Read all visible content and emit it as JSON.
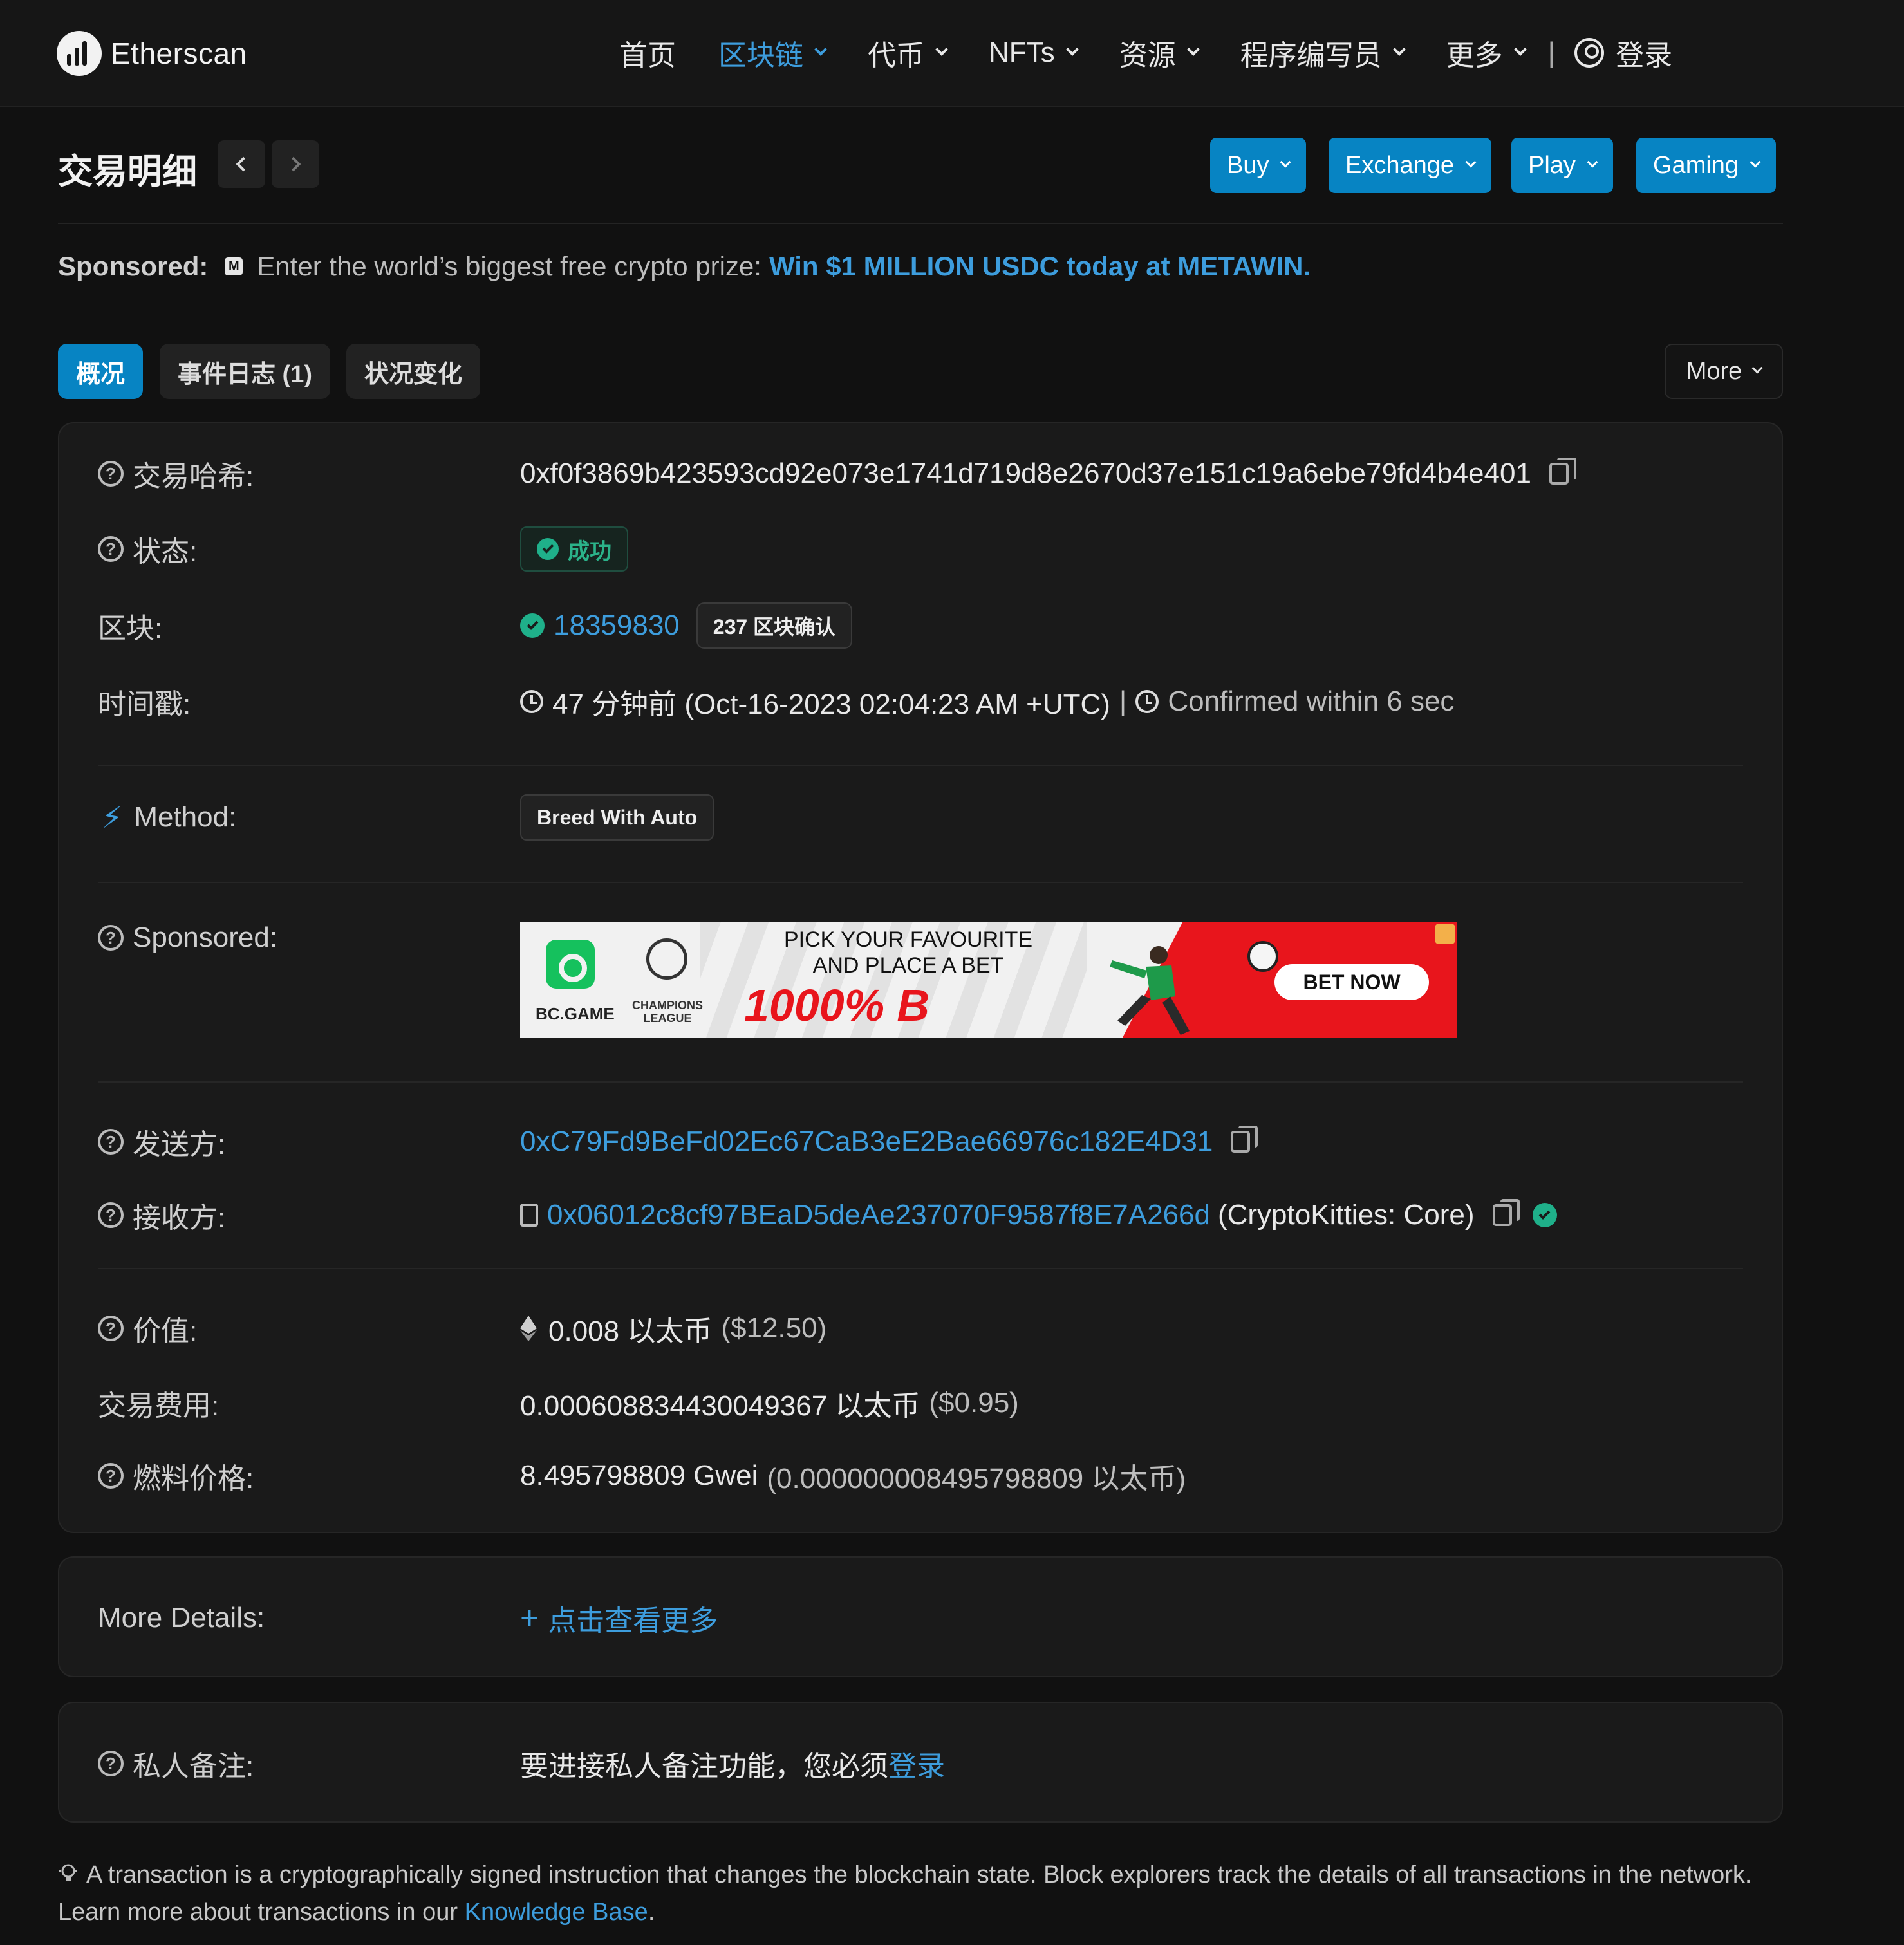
{
  "app": {
    "brand": "Etherscan"
  },
  "nav": {
    "items": [
      {
        "label": "首页",
        "active": false,
        "dropdown": false
      },
      {
        "label": "区块链",
        "active": true,
        "dropdown": true
      },
      {
        "label": "代币",
        "active": false,
        "dropdown": true
      },
      {
        "label": "NFTs",
        "active": false,
        "dropdown": true
      },
      {
        "label": "资源",
        "active": false,
        "dropdown": true
      },
      {
        "label": "程序编写员",
        "active": false,
        "dropdown": true
      },
      {
        "label": "更多",
        "active": false,
        "dropdown": true
      }
    ],
    "separator": "|",
    "login_label": "登录"
  },
  "page": {
    "title": "交易明细"
  },
  "cta_buttons": [
    {
      "label": "Buy"
    },
    {
      "label": "Exchange"
    },
    {
      "label": "Play"
    },
    {
      "label": "Gaming"
    }
  ],
  "sponsored_line": {
    "prefix": "Sponsored:",
    "text": "Enter the world’s biggest free crypto prize:",
    "link": "Win $1 MILLION USDC today at METAWIN."
  },
  "tabs": [
    {
      "label": "概况",
      "active": true
    },
    {
      "label": "事件日志 (1)",
      "active": false
    },
    {
      "label": "状况变化",
      "active": false
    }
  ],
  "more_button": "More",
  "details": {
    "hash_label": "交易哈希:",
    "hash_value": "0xf0f3869b423593cd92e073e1741d719d8e2670d37e151c19a6ebe79fd4b4e401",
    "status_label": "状态:",
    "status_value": "成功",
    "block_label": "区块:",
    "block_value": "18359830",
    "block_confirmations": "237 区块确认",
    "timestamp_label": "时间戳:",
    "timestamp_value": "47 分钟前 (Oct-16-2023 02:04:23 AM +UTC)",
    "timestamp_sep": "|",
    "confirmed_within": "Confirmed within 6 sec",
    "method_label": "Method:",
    "method_value": "Breed With Auto",
    "sponsored_label": "Sponsored:",
    "from_label": "发送方:",
    "from_value": "0xC79Fd9BeFd02Ec67CaB3eE2Bae66976c182E4D31",
    "to_label": "接收方:",
    "to_value": "0x06012c8cf97BEaD5deAe237070F9587f8E7A266d",
    "to_name": "(CryptoKitties: Core)",
    "value_label": "价值:",
    "value_amount": "0.008 以太币",
    "value_usd": "($12.50)",
    "fee_label": "交易费用:",
    "fee_amount": "0.000608834430049367 以太币",
    "fee_usd": "($0.95)",
    "gas_label": "燃料价格:",
    "gas_amount": "8.495798809 Gwei",
    "gas_eth": "(0.000000008495798809 以太币)"
  },
  "banner": {
    "brand": "BC.GAME",
    "league": "CHAMPIONS LEAGUE",
    "headline_1": "PICK YOUR FAVOURITE",
    "headline_2": "AND PLACE A BET",
    "promo": "1000% B",
    "cta": "BET NOW"
  },
  "more_details": {
    "label": "More Details:",
    "link": "点击查看更多"
  },
  "private_note": {
    "label": "私人备注:",
    "text": "要进接私人备注功能，您必须",
    "link": "登录"
  },
  "footer": {
    "text": "A transaction is a cryptographically signed instruction that changes the blockchain state. Block explorers track the details of all transactions in the network. Learn more about transactions in our",
    "link": "Knowledge Base",
    "end": "."
  },
  "colors": {
    "background": "#111111",
    "card": "#1a1a1a",
    "accent": "#0784c3",
    "link": "#3d9ddd",
    "success": "#1fb08a"
  }
}
